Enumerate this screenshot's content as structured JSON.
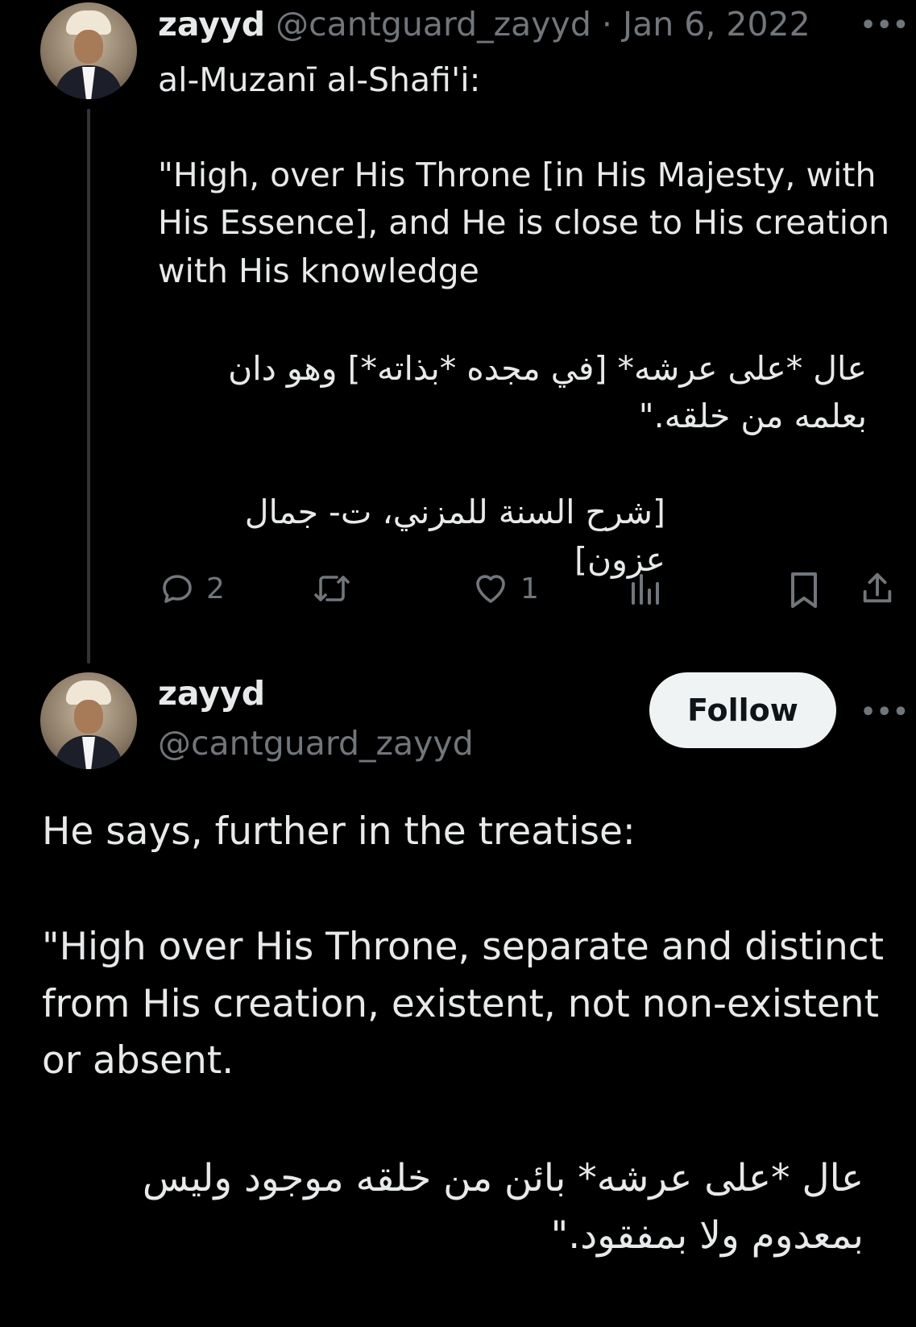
{
  "tweet1": {
    "display_name": "zayyd",
    "handle": "@cantguard_zayyd",
    "separator": "·",
    "date": "Jan 6, 2022",
    "more_glyph": "•••",
    "lines": [
      "al-Muzanī al-Shafi'i:",
      "\"High, over His Throne [in His Majesty, with His Essence], and He is close to His creation with His knowledge",
      "عال *على عرشه* [في مجده *بذاته*] وهو دان بعلمه من خلقه.\"",
      "[شرح السنة للمزني، ت- جمال عزون]"
    ],
    "actions": {
      "reply_count": "2",
      "retweet_count": "",
      "like_count": "1",
      "views_count": ""
    }
  },
  "tweet2": {
    "display_name": "zayyd",
    "handle": "@cantguard_zayyd",
    "follow_label": "Follow",
    "more_glyph": "•••",
    "paragraphs": [
      "He says, further in the treatise:",
      "\"High over His Throne, separate and distinct from His creation, existent, not non-existent or absent.",
      "عال *على عرشه* بائن من خلقه موجود وليس بمعدوم ولا بمفقود.\""
    ]
  },
  "colors": {
    "background": "#000000",
    "text": "#e7e9ea",
    "muted": "#71767b",
    "follow_bg": "#eff3f4",
    "thread_line": "#333639"
  }
}
